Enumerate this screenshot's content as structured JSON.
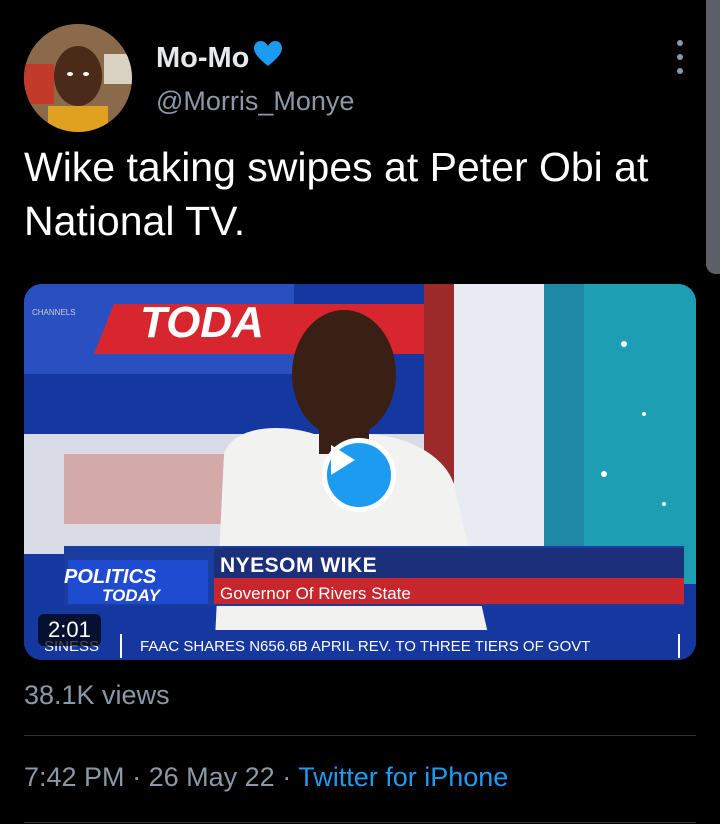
{
  "user": {
    "display_name": "Mo-Mo",
    "handle": "@Morris_Monye",
    "avatar_icon": "user-avatar-photo"
  },
  "tweet": {
    "text": "Wike taking swipes at Peter Obi at National TV."
  },
  "media": {
    "duration": "2:01",
    "banner_top": "TODA",
    "banner_small": "CHANNELS",
    "logo_politics": "POLITICS",
    "logo_today": "TODAY",
    "lower_third_name": "NYESOM WIKE",
    "lower_third_title": "Governor Of Rivers State",
    "ticker_left": "SINESS",
    "ticker_main": "FAAC SHARES N656.6B APRIL REV. TO THREE TIERS OF GOVT"
  },
  "stats": {
    "views": "38.1K views"
  },
  "meta": {
    "time": "7:42 PM",
    "separator": "·",
    "date": "26 May 22",
    "source": "Twitter for iPhone"
  },
  "colors": {
    "accent": "#1d9bf0",
    "secondary_text": "#8b98a5",
    "heart_emoji": "#1d9bf0"
  }
}
